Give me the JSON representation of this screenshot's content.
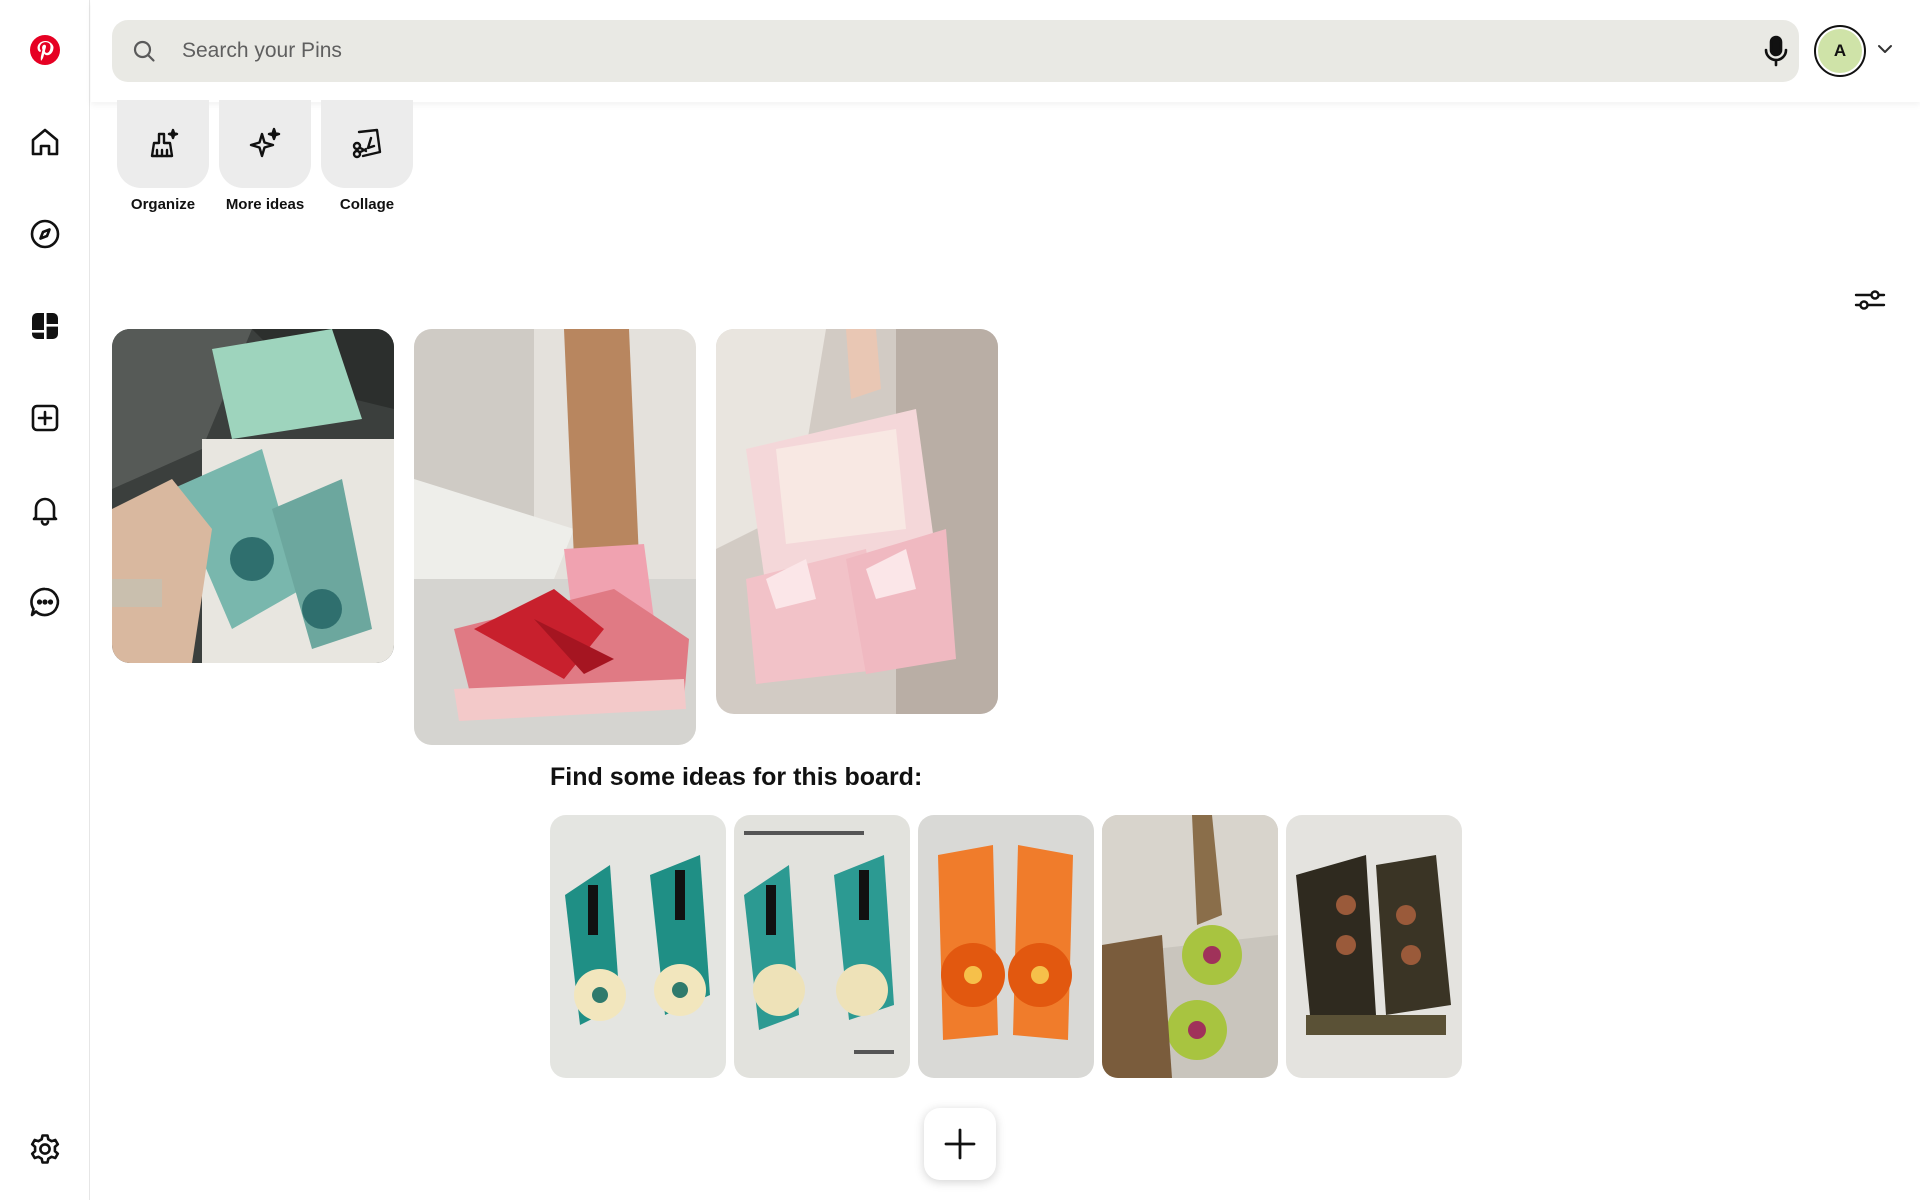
{
  "sidebar": {
    "items": [
      {
        "name": "pinterest-logo",
        "label": "Pinterest"
      },
      {
        "name": "home",
        "label": "Home"
      },
      {
        "name": "explore",
        "label": "Explore"
      },
      {
        "name": "boards",
        "label": "Boards"
      },
      {
        "name": "create",
        "label": "Create"
      },
      {
        "name": "notifications",
        "label": "Notifications"
      },
      {
        "name": "messages",
        "label": "Messages"
      },
      {
        "name": "settings",
        "label": "Settings"
      }
    ]
  },
  "header": {
    "search_placeholder": "Search your Pins",
    "avatar_initial": "A"
  },
  "tools": {
    "organize": "Organize",
    "more_ideas": "More ideas",
    "collage": "Collage"
  },
  "ideas": {
    "title": "Find some ideas for this board:"
  },
  "colors": {
    "brand": "#e60023",
    "search_bg": "#e9e9e4",
    "avatar_bg": "#cfe3a8"
  }
}
